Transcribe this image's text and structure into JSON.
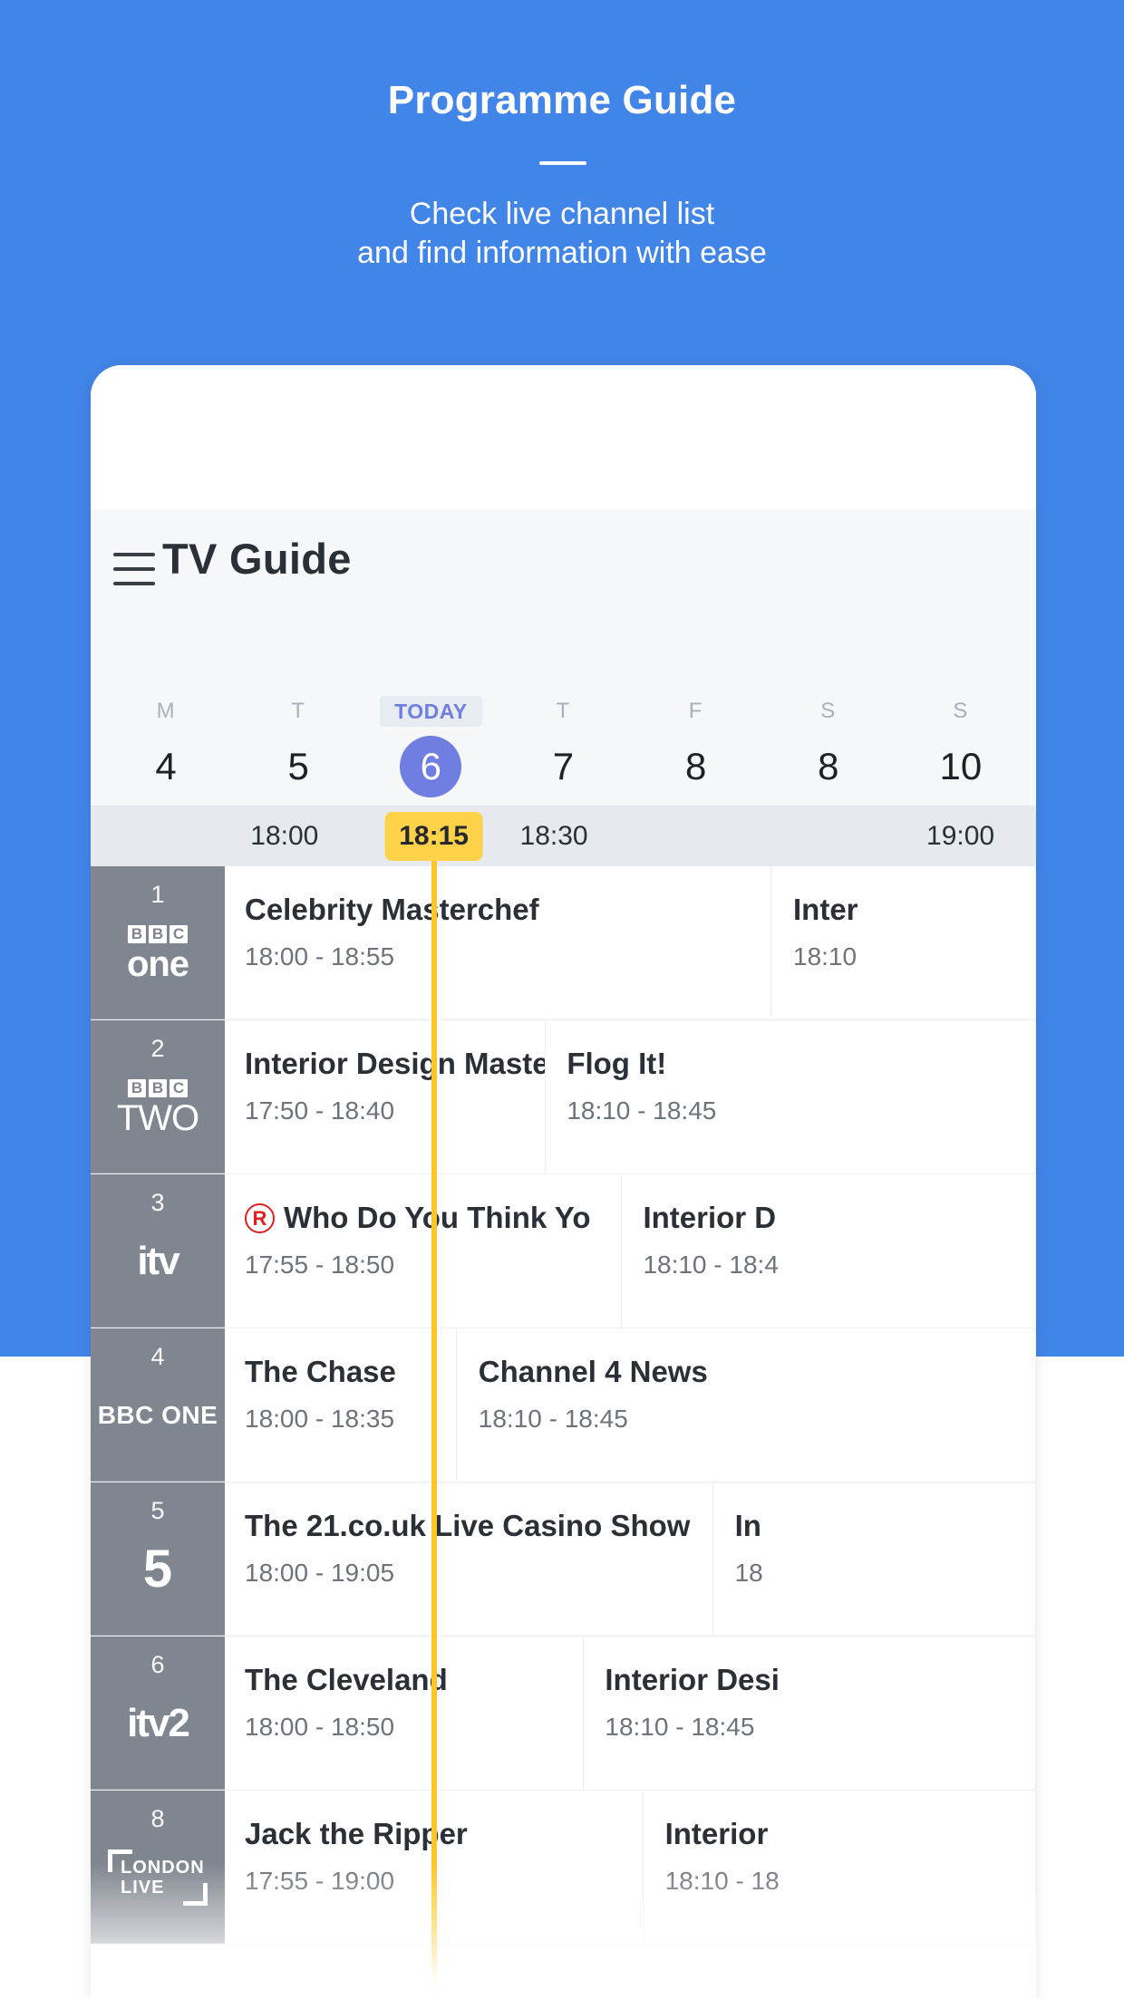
{
  "hero": {
    "title": "Programme Guide",
    "subtitle_line1": "Check live channel list",
    "subtitle_line2": "and find information with ease",
    "bg_color": "#4285e8"
  },
  "app": {
    "title": "TV Guide",
    "menu_icon": "hamburger-icon"
  },
  "dates": [
    {
      "dow": "M",
      "day": "4",
      "today": false,
      "selected": false
    },
    {
      "dow": "T",
      "day": "5",
      "today": false,
      "selected": false
    },
    {
      "dow": "TODAY",
      "day": "6",
      "today": true,
      "selected": true
    },
    {
      "dow": "T",
      "day": "7",
      "today": false,
      "selected": false
    },
    {
      "dow": "F",
      "day": "8",
      "today": false,
      "selected": false
    },
    {
      "dow": "S",
      "day": "8",
      "today": false,
      "selected": false
    },
    {
      "dow": "S",
      "day": "10",
      "today": false,
      "selected": false
    }
  ],
  "timeline": {
    "labels": [
      {
        "text": "18:00",
        "pos_pct": 20.5,
        "now": false
      },
      {
        "text": "18:15",
        "pos_pct": 36.3,
        "now": true
      },
      {
        "text": "18:30",
        "pos_pct": 49.0,
        "now": false
      },
      {
        "text": "19:00",
        "pos_pct": 92.0,
        "now": false
      }
    ],
    "now_marker_time": "18:15",
    "now_marker_pos_pct": 36.3,
    "now_marker_color": "#ffc627",
    "highlight_color": "#ffd24a"
  },
  "channels": [
    {
      "number": "1",
      "logo_type": "bbc-one",
      "logo_text": "one",
      "logo_boxes": [
        "B",
        "B",
        "C"
      ],
      "programmes": [
        {
          "title": "Celebrity Masterchef",
          "time": "18:00 - 18:55",
          "left_pct": 0,
          "width_pct": 67.4,
          "repeat": false
        },
        {
          "title": "Inter",
          "time": "18:10",
          "left_pct": 67.6,
          "width_pct": 32.4,
          "repeat": false
        }
      ]
    },
    {
      "number": "2",
      "logo_type": "bbc-two",
      "logo_text": "TWO",
      "logo_boxes": [
        "B",
        "B",
        "C"
      ],
      "programmes": [
        {
          "title": "Interior Design Maste",
          "time": "17:50 - 18:40",
          "left_pct": 0,
          "width_pct": 39.5,
          "repeat": false
        },
        {
          "title": "Flog It!",
          "time": "18:10 - 18:45",
          "left_pct": 39.7,
          "width_pct": 60.3,
          "repeat": false
        }
      ]
    },
    {
      "number": "3",
      "logo_type": "itv",
      "logo_text": "itv",
      "programmes": [
        {
          "title": "Who Do You Think Yo",
          "time": "17:55 - 18:50",
          "left_pct": 0,
          "width_pct": 48.9,
          "repeat": true
        },
        {
          "title": "Interior D",
          "time": "18:10 - 18:4",
          "left_pct": 49.1,
          "width_pct": 50.9,
          "repeat": false
        }
      ]
    },
    {
      "number": "4",
      "logo_type": "plain",
      "logo_text": "BBC ONE",
      "programmes": [
        {
          "title": "The Chase",
          "time": "18:00 - 18:35",
          "left_pct": 0,
          "width_pct": 28.6,
          "repeat": false
        },
        {
          "title": "Channel 4 News",
          "time": "18:10 - 18:45",
          "left_pct": 28.8,
          "width_pct": 71.2,
          "repeat": false
        }
      ]
    },
    {
      "number": "5",
      "logo_type": "five",
      "logo_text": "5",
      "programmes": [
        {
          "title": "The 21.co.uk Live Casino Show",
          "time": "18:00 - 19:05",
          "left_pct": 0,
          "width_pct": 60.2,
          "repeat": false
        },
        {
          "title": "In",
          "time": "18",
          "left_pct": 60.4,
          "width_pct": 39.6,
          "repeat": false
        }
      ]
    },
    {
      "number": "6",
      "logo_type": "itv2",
      "logo_text": "itv2",
      "programmes": [
        {
          "title": "The Cleveland",
          "time": "18:00 - 18:50",
          "left_pct": 0,
          "width_pct": 44.2,
          "repeat": false
        },
        {
          "title": "Interior Desi",
          "time": "18:10 - 18:45",
          "left_pct": 44.4,
          "width_pct": 55.6,
          "repeat": false
        }
      ]
    },
    {
      "number": "8",
      "logo_type": "london-live",
      "logo_text": "LONDON LIVE",
      "logo_line1": "LONDON",
      "logo_line2": "LIVE",
      "programmes": [
        {
          "title": "Jack the Ripper",
          "time": "17:55 - 19:00",
          "left_pct": 0,
          "width_pct": 51.6,
          "repeat": false
        },
        {
          "title": "Interior",
          "time": "18:10 - 18",
          "left_pct": 51.8,
          "width_pct": 48.2,
          "repeat": false
        }
      ]
    }
  ]
}
